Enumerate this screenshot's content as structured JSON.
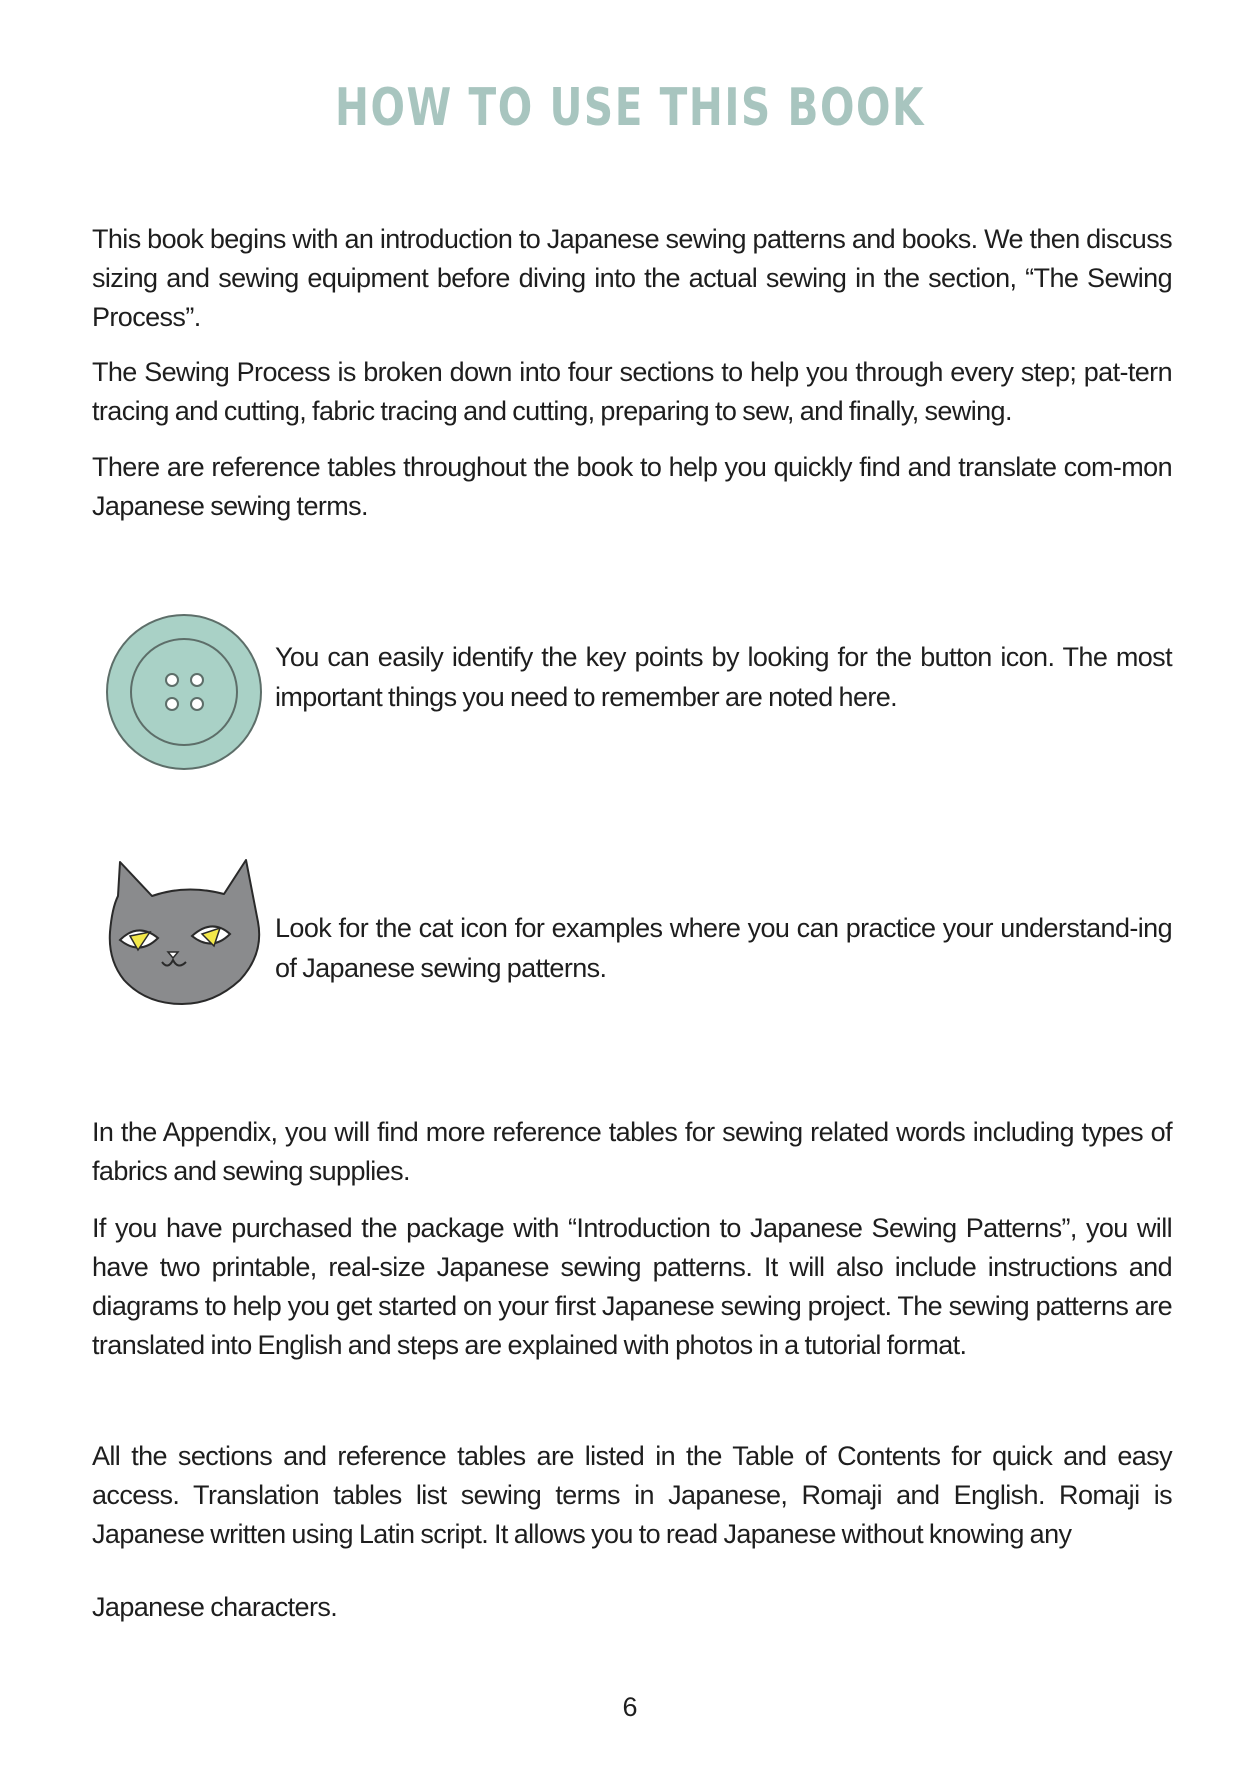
{
  "page": {
    "title": "HOW TO USE THIS BOOK",
    "page_number": "6"
  },
  "intro": {
    "p1": "This book begins with an introduction to Japanese sewing patterns and books. We then discuss sizing and sewing equipment before diving into the actual sewing in the section, “The Sewing Process”.",
    "p2": "The Sewing Process is broken down into four sections to help you through every step; pat-tern tracing and cutting, fabric tracing and cutting, preparing to sew, and finally, sewing.",
    "p3": "There are reference tables throughout the book to help you quickly find and translate com-mon Japanese sewing terms."
  },
  "callouts": {
    "button": {
      "icon": "button-icon",
      "text": "You can easily identify the key points by looking for the button icon. The most important things you need to remember are noted here."
    },
    "cat": {
      "icon": "cat-icon",
      "text": "Look for the cat icon for examples where you can practice your understand-ing of Japanese sewing patterns."
    }
  },
  "appendix": {
    "p1": "In the Appendix, you will find more reference tables for sewing related words including types of fabrics and sewing supplies.",
    "p2": "If you have purchased the package with “Introduction to Japanese Sewing Patterns”, you will have two printable, real-size Japanese sewing patterns. It will also include instructions and diagrams to help you get started on your first Japanese sewing project. The sewing patterns are translated into English and steps are explained with photos in a tutorial format.",
    "p3": "All the sections and reference tables are listed in the Table of Contents for quick and easy access. Translation tables list sewing terms in Japanese, Romaji and English. Romaji is Japanese written using Latin script. It allows you to read Japanese without knowing any",
    "p4": "Japanese characters."
  },
  "colors": {
    "title": "#a8c5bf",
    "button_fill": "#a9d1c6",
    "cat_fill": "#8a8b8d",
    "cat_eye": "#f3e84a"
  }
}
